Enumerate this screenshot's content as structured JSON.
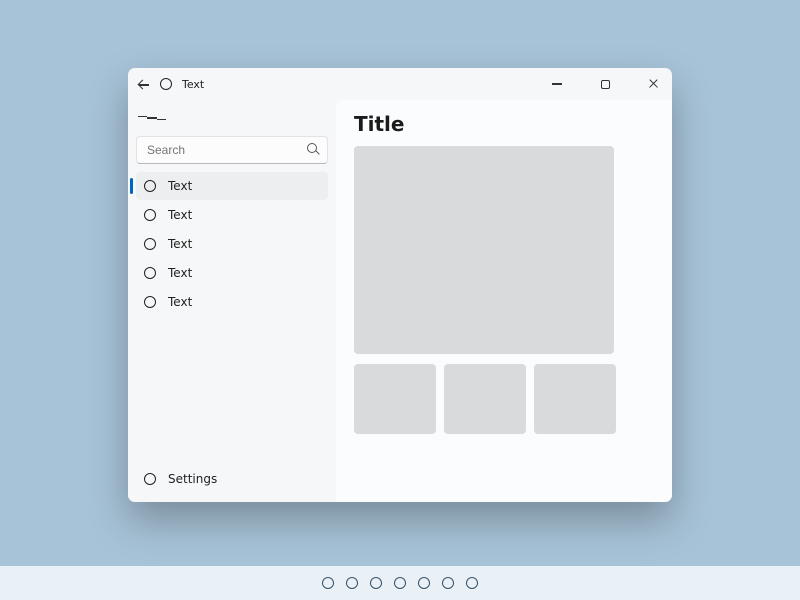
{
  "titlebar": {
    "title": "Text"
  },
  "search": {
    "placeholder": "Search"
  },
  "nav": {
    "items": [
      {
        "label": "Text"
      },
      {
        "label": "Text"
      },
      {
        "label": "Text"
      },
      {
        "label": "Text"
      },
      {
        "label": "Text"
      }
    ],
    "footer": {
      "label": "Settings"
    }
  },
  "content": {
    "title": "Title"
  },
  "taskbar": {
    "icon_count": 7
  }
}
